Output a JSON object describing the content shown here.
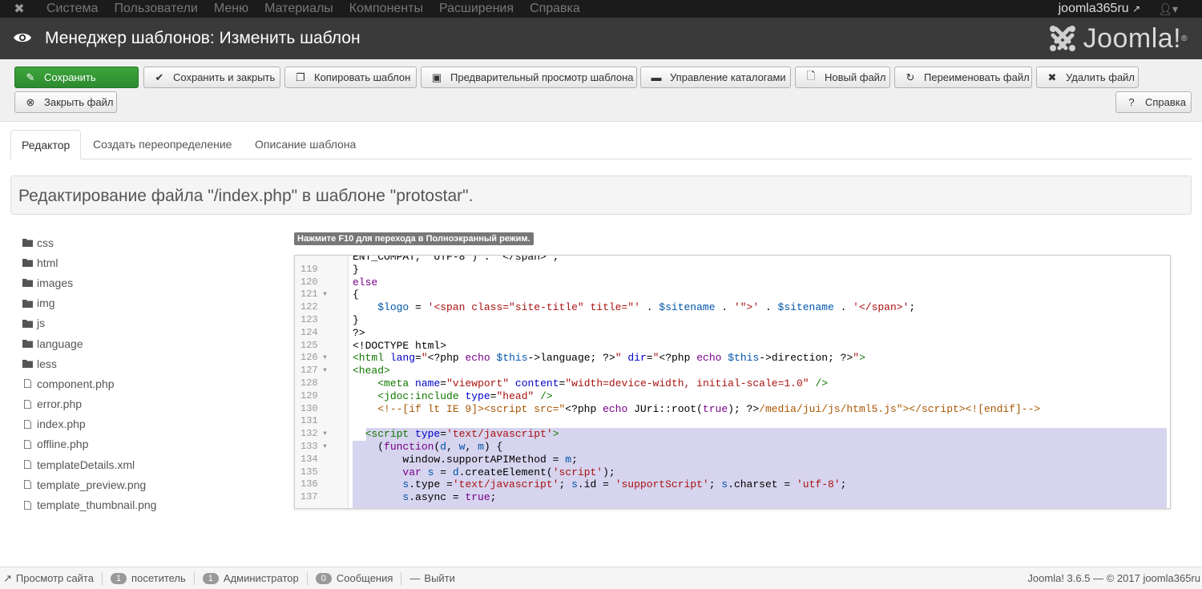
{
  "topnav": {
    "items": [
      "Система",
      "Пользователи",
      "Меню",
      "Материалы",
      "Компоненты",
      "Расширения",
      "Справка"
    ],
    "site_name": "joomla365ru",
    "user_icon": "user-icon"
  },
  "header": {
    "title": "Менеджер шаблонов: Изменить шаблон",
    "brand": "Joomla!",
    "brand_mark": "®"
  },
  "toolbar": {
    "save": "Сохранить",
    "save_close": "Сохранить и закрыть",
    "copy": "Копировать шаблон",
    "preview": "Предварительный просмотр шаблона",
    "manage_folders": "Управление каталогами",
    "new_file": "Новый файл",
    "rename_file": "Переименовать файл",
    "delete_file": "Удалить файл",
    "close_file": "Закрыть файл",
    "help": "Справка"
  },
  "tabs": [
    "Редактор",
    "Создать переопределение",
    "Описание шаблона"
  ],
  "edit_info": "Редактирование файла \"/index.php\" в шаблоне \"protostar\".",
  "hint": "Нажмите F10 для перехода в Полноэкранный режим.",
  "tree": {
    "folders": [
      "css",
      "html",
      "images",
      "img",
      "js",
      "language",
      "less"
    ],
    "files": [
      "component.php",
      "error.php",
      "index.php",
      "offline.php",
      "templateDetails.xml",
      "template_preview.png",
      "template_thumbnail.png"
    ]
  },
  "editor": {
    "top_partial": "ENT_COMPAT, 'UTF-8') . '</span>';",
    "line_numbers": [
      "119",
      "120",
      "121",
      "122",
      "123",
      "124",
      "125",
      "126",
      "127",
      "128",
      "129",
      "130",
      "131",
      "132",
      "133",
      "134",
      "135",
      "136",
      "137"
    ],
    "highlight_color": "#d6d4ee"
  },
  "statusbar": {
    "view_site": "Просмотр сайта",
    "visitors_count": "1",
    "visitors_label": "посетитель",
    "admins_count": "1",
    "admins_label": "Администратор",
    "messages_count": "0",
    "messages_label": "Сообщения",
    "logout": "Выйти",
    "version": "Joomla! 3.6.5",
    "sep": "—",
    "copyright": "© 2017 joomla365ru"
  }
}
